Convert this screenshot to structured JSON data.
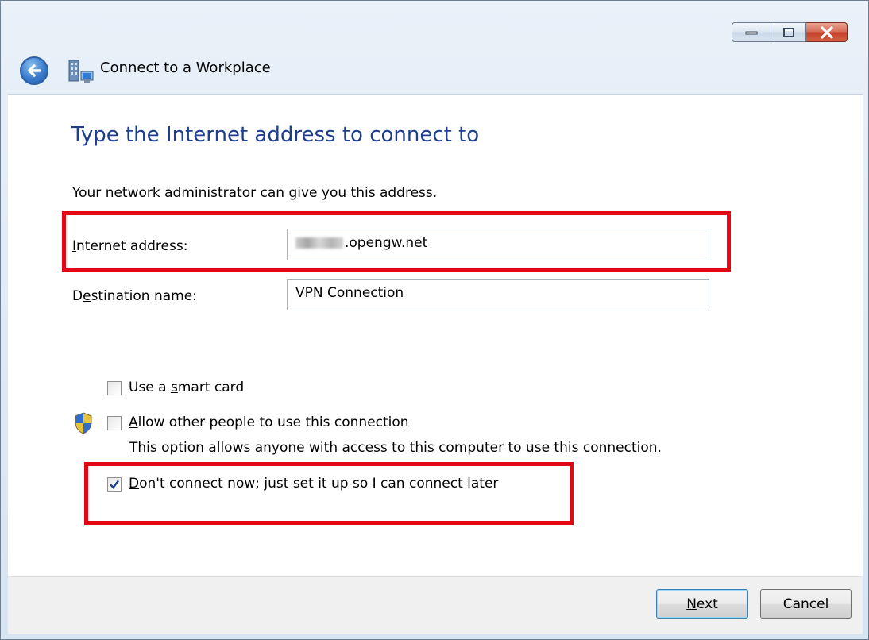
{
  "window": {
    "title": "Connect to a Workplace"
  },
  "main": {
    "heading": "Type the Internet address to connect to",
    "description": "Your network administrator can give you this address.",
    "internet_address": {
      "label_pre": "I",
      "label_rest": "nternet address:",
      "value": ".opengw.net"
    },
    "destination_name": {
      "label_pre": "D",
      "label_mid": "e",
      "label_rest": "stination name:",
      "value": "VPN Connection"
    },
    "options": {
      "smart_card": {
        "pre": "Use a ",
        "mn": "s",
        "post": "mart card",
        "checked": false
      },
      "allow_others": {
        "mn": "A",
        "post": "llow other people to use this connection",
        "checked": false,
        "description": "This option allows anyone with access to this computer to use this connection."
      },
      "dont_connect": {
        "mn": "D",
        "post": "on't connect now; just set it up so I can connect later",
        "checked": true
      }
    }
  },
  "footer": {
    "next_pre": "N",
    "next_rest": "ext",
    "cancel": "Cancel"
  },
  "colors": {
    "heading": "#1e3e8c",
    "highlight": "#e30613"
  }
}
